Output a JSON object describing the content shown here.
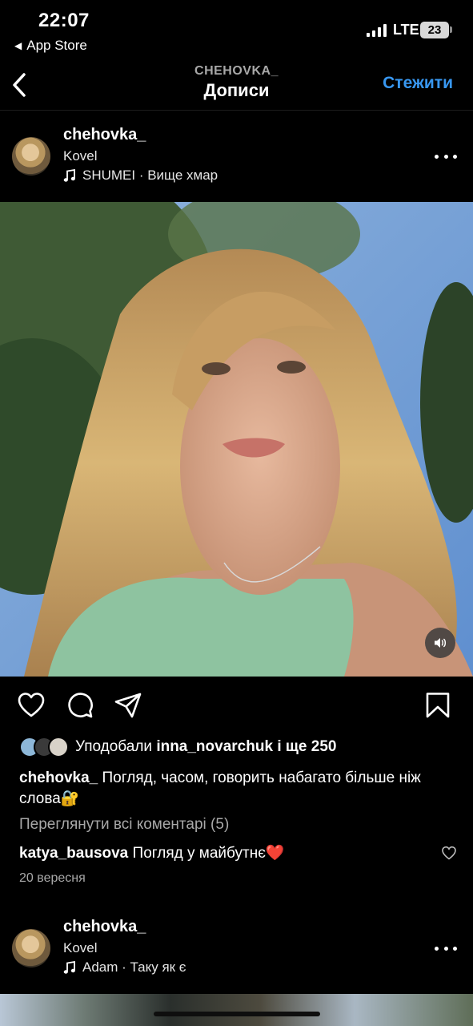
{
  "status_bar": {
    "time": "22:07",
    "back_app": "App Store",
    "network": "LTE",
    "battery": "23"
  },
  "header": {
    "account": "CHEHOVKA_",
    "title": "Дописи",
    "follow_label": "Стежити"
  },
  "post": {
    "username": "chehovka_",
    "location": "Kovel",
    "music": "SHUMEI · Вище хмар",
    "likes_prefix": "Уподобали",
    "likes_user": "inna_novarchuk",
    "likes_suffix": "і ще 250",
    "caption_user": "chehovka_",
    "caption_text": "Погляд, часом, говорить набагато більше ніж слова🔐",
    "view_comments": "Переглянути всі коментарі (5)",
    "comment_user": "katya_bausova",
    "comment_text": "Погляд у майбутнє❤️",
    "date": "20 вересня"
  },
  "next_post": {
    "username": "chehovka_",
    "location": "Kovel",
    "music": "Adam · Таку як є"
  },
  "colors": {
    "accent": "#3897f0",
    "background": "#000000",
    "muted_text": "#a8a8a8"
  },
  "icons": [
    "chevron-left-icon",
    "ellipsis-icon",
    "music-note-icon",
    "heart-icon",
    "comment-icon",
    "share-icon",
    "bookmark-icon",
    "volume-icon"
  ]
}
